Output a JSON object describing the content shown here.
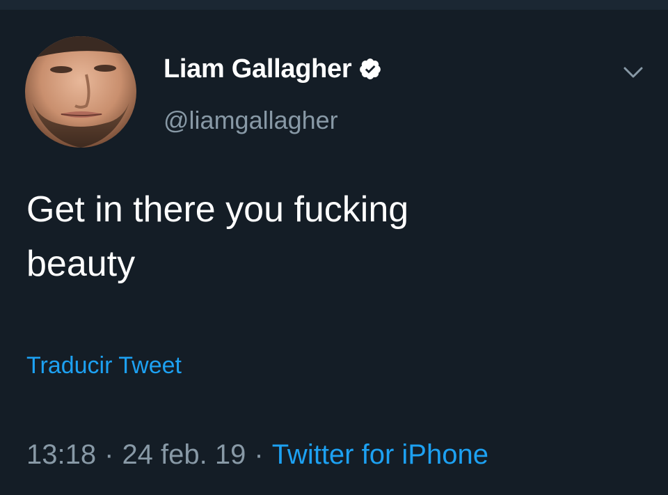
{
  "tweet": {
    "author": {
      "display_name": "Liam Gallagher",
      "handle": "@liamgallagher",
      "verified": true,
      "avatar_icon": "user-avatar"
    },
    "text_line1": "Get in there you fucking",
    "text_line2": "beauty",
    "translate_label": "Traducir Tweet",
    "time": "13:18",
    "date": "24 feb. 19",
    "source": "Twitter for iPhone",
    "separator": "·"
  },
  "colors": {
    "background": "#141d26",
    "text_primary": "#ffffff",
    "text_secondary": "#8899a6",
    "link": "#1da1f2"
  },
  "icons": {
    "verified": "verified-badge-icon",
    "menu": "chevron-down-icon"
  }
}
